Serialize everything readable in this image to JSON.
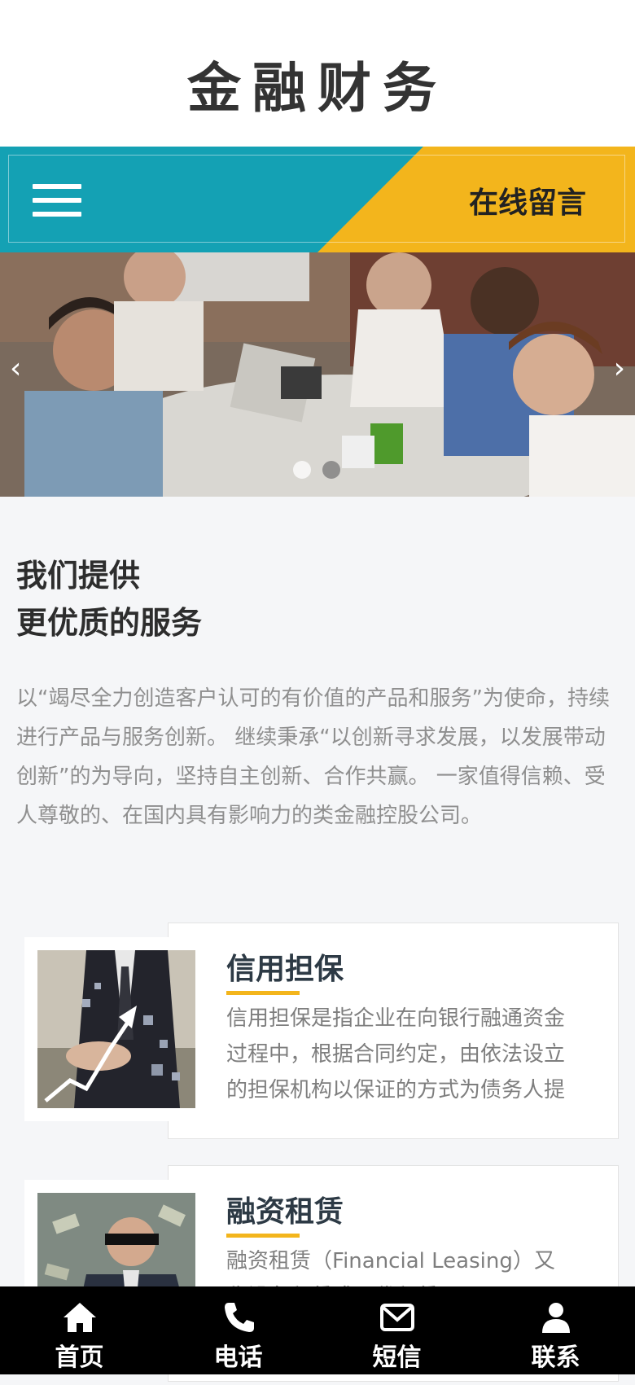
{
  "logo": {
    "text": "金融财务"
  },
  "nav": {
    "message_label": "在线留言"
  },
  "banner": {
    "prev_arrow": "‹",
    "next_arrow": "›",
    "slide_count": 2,
    "active_slide": 1
  },
  "intro": {
    "title_line1": "我们提供",
    "title_line2": "更优质的服务",
    "text": "以“竭尽全力创造客户认可的有价值的产品和服务”为使命，持续进行产品与服务创新。 继续秉承“以创新寻求发展，以发展带动创新”的为导向，坚持自主创新、合作共赢。 一家值得信赖、受人尊敬的、在国内具有影响力的类金融控股公司。"
  },
  "services": [
    {
      "title": "信用担保",
      "desc": "信用担保是指企业在向银行融通资金过程中，根据合同约定，由依法设立的担保机构以保证的方式为债务人提供担保"
    },
    {
      "title": "融资租赁",
      "desc": "融资租赁（Financial Leasing）又称设备租赁或现代租赁"
    }
  ],
  "bottom_nav": [
    {
      "label": "首页",
      "icon": "home-icon"
    },
    {
      "label": "电话",
      "icon": "phone-icon"
    },
    {
      "label": "短信",
      "icon": "envelope-icon"
    },
    {
      "label": "联系",
      "icon": "user-icon"
    }
  ],
  "colors": {
    "teal": "#14a1b4",
    "yellow": "#f3b51c",
    "text_dark": "#2d2d2d",
    "text_gray": "#8f8f8f"
  }
}
